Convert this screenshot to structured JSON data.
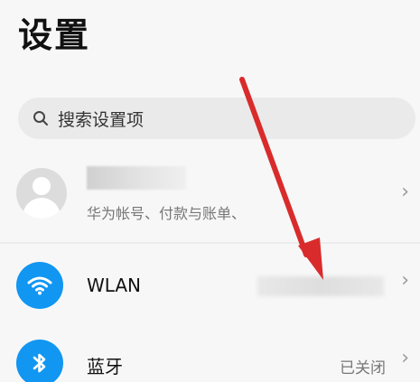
{
  "header": {
    "title": "设置"
  },
  "search": {
    "placeholder": "搜索设置项",
    "icon": "search-icon"
  },
  "account": {
    "subtitle": "华为帐号、付款与账单、",
    "avatar_icon": "avatar-icon",
    "chevron": "›"
  },
  "settings": {
    "wlan": {
      "label": "WLAN",
      "icon": "wifi-icon",
      "chevron": "›",
      "icon_color": "#1196f2"
    },
    "bluetooth": {
      "label": "蓝牙",
      "value": "已关闭",
      "icon": "bluetooth-icon",
      "chevron": "›",
      "icon_color": "#1196f2"
    }
  },
  "annotation": {
    "arrow_color": "#d92b2b"
  }
}
